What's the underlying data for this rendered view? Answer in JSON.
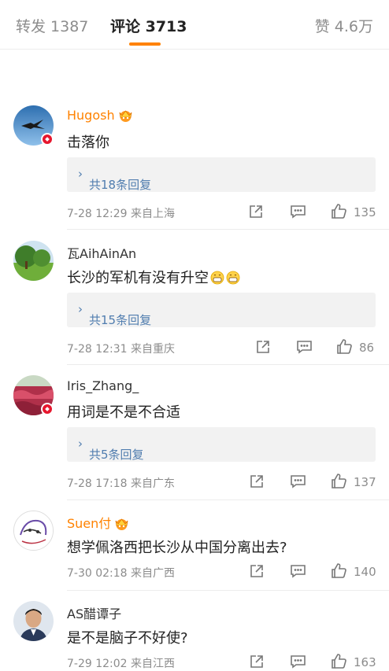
{
  "tabs": {
    "repost": "转发 1387",
    "comments": "评论 3713",
    "likes": "赞 4.6万"
  },
  "comments": [
    {
      "username": "Hugosh",
      "user_badge": "crown-icon",
      "text": "击落你",
      "replies": "共18条回复",
      "meta": "7-28 12:29  来自上海",
      "likes": "135",
      "avatar_badge": true
    },
    {
      "username": "瓦AihAinAn",
      "user_badge": "",
      "text": "长沙的军机有没有升空",
      "text_emoji": "grin-emoji",
      "replies": "共15条回复",
      "meta": "7-28 12:31  来自重庆",
      "likes": "86",
      "avatar_badge": false
    },
    {
      "username": "Iris_Zhang_",
      "user_badge": "",
      "text": "用词是不是不合适",
      "replies": "共5条回复",
      "meta": "7-28 17:18  来自广东",
      "likes": "137",
      "avatar_badge": true
    },
    {
      "username": "Suen付",
      "user_badge": "crown-icon",
      "text": "想学佩洛西把长沙从中国分离出去?",
      "replies": "",
      "meta": "7-30 02:18  来自广西",
      "likes": "140",
      "avatar_badge": false
    },
    {
      "username": "AS醋谭子",
      "user_badge": "",
      "text": "是不是脑子不好使?",
      "replies": "",
      "meta": "7-29 12:02  来自江西",
      "likes": "163",
      "avatar_badge": false
    }
  ],
  "colors": {
    "accent": "#ff8200",
    "link": "#507daf",
    "badge": "#e6162d"
  },
  "reply_arrow": "›"
}
